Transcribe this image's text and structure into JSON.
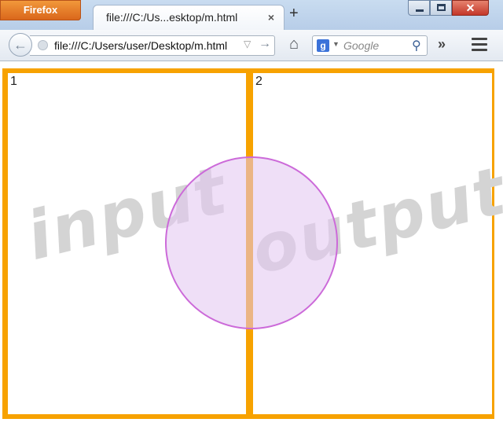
{
  "window": {
    "app_button": "Firefox",
    "tab_title": "file:///C:/Us...esktop/m.html",
    "tab_close": "×",
    "new_tab": "+",
    "close_glyph": "✕"
  },
  "navbar": {
    "back_glyph": "←",
    "url": "file:///C:/Users/user/Desktop/m.html",
    "dropmarker": "▽",
    "go_glyph": "→",
    "home_glyph": "⌂",
    "search_engine_letter": "g",
    "search_engine_drop": "▼",
    "search_placeholder": "Google",
    "search_glyph": "⚲",
    "overflow_glyph": "»"
  },
  "content": {
    "pane_left_number": "1",
    "pane_right_number": "2",
    "watermark_left": "input",
    "watermark_right": "output",
    "frame_color": "#f7a200",
    "circle_fill": "#e2c4f0",
    "circle_stroke": "#cc6ad9"
  }
}
